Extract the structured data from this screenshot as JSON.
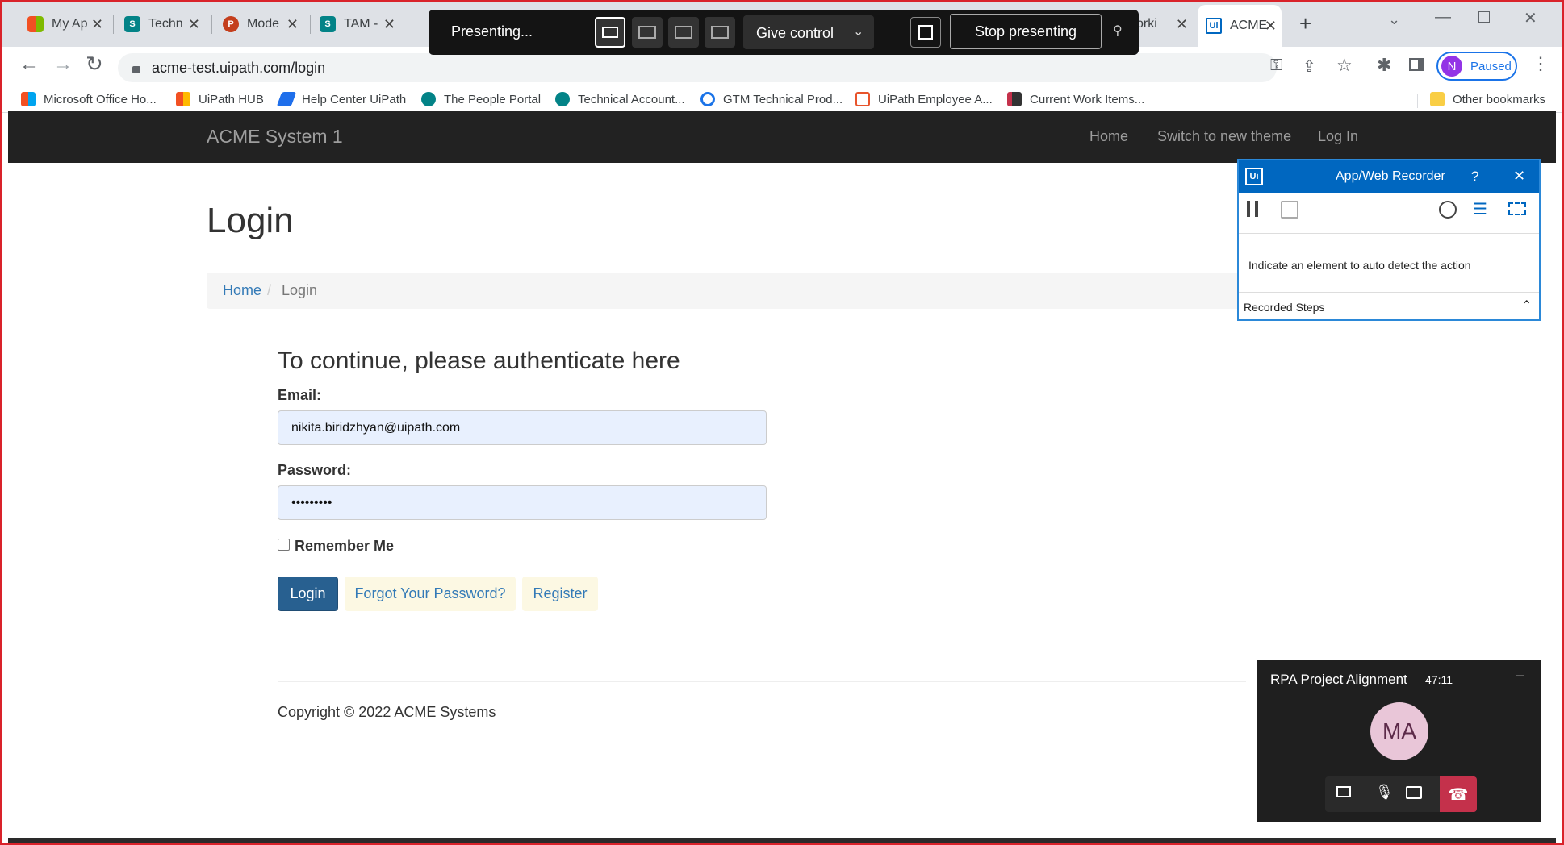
{
  "browser": {
    "tabs": [
      {
        "label": "My Ap"
      },
      {
        "label": "Techn"
      },
      {
        "label": "Mode"
      },
      {
        "label": "TAM -"
      },
      {
        "label": "orki"
      },
      {
        "label": "ACME"
      }
    ],
    "url": "acme-test.uipath.com/login",
    "profile_label": "Paused",
    "profile_initial": "N",
    "bookmarks": [
      "Microsoft Office Ho...",
      "UiPath HUB",
      "Help Center UiPath",
      "The People Portal",
      "Technical Account...",
      "GTM Technical Prod...",
      "UiPath Employee A...",
      "Current Work Items..."
    ],
    "other_bookmarks": "Other bookmarks"
  },
  "presenting": {
    "status": "Presenting...",
    "give_control": "Give control",
    "stop": "Stop presenting"
  },
  "site": {
    "brand": "ACME System 1",
    "nav": [
      "Home",
      "Switch to new theme",
      "Log In"
    ],
    "page_title": "Login",
    "breadcrumb": {
      "home": "Home",
      "sep": "/",
      "current": "Login"
    },
    "subheading": "To continue, please authenticate here",
    "email_label": "Email:",
    "email_value": "nikita.biridzhyan@uipath.com",
    "password_label": "Password:",
    "password_value": "•••••••••",
    "remember_label": "Remember Me",
    "login_button": "Login",
    "forgot_button": "Forgot Your Password?",
    "register_button": "Register",
    "copyright": "Copyright © 2022 ACME Systems"
  },
  "recorder": {
    "title": "App/Web Recorder",
    "help": "?",
    "message": "Indicate an element to auto detect the action",
    "recorded_steps": "Recorded Steps"
  },
  "meeting": {
    "title": "RPA Project Alignment",
    "timer": "47:11",
    "avatar_initials": "MA"
  },
  "colors": {
    "navbar": "#222222",
    "primary_button": "#286090",
    "link": "#337ab7",
    "recorder_header": "#0067c0",
    "hangup": "#c4314b",
    "frame": "#d9222a"
  }
}
